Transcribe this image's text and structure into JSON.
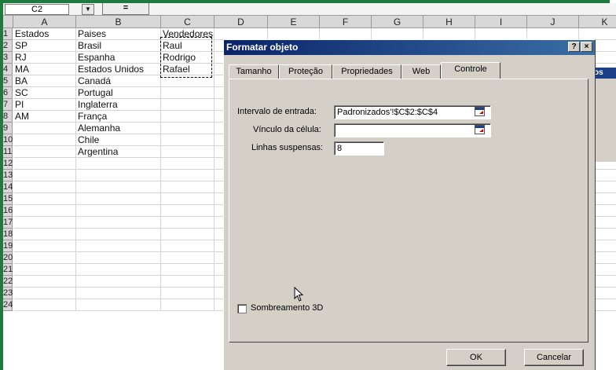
{
  "formula_bar": {
    "name_box": "C2",
    "equals": "="
  },
  "columns": [
    "A",
    "B",
    "C",
    "D",
    "E",
    "F",
    "G",
    "H",
    "I",
    "J",
    "K"
  ],
  "rows": [
    "1",
    "2",
    "3",
    "4",
    "5",
    "6",
    "7",
    "8",
    "9",
    "10",
    "11",
    "12",
    "13",
    "14",
    "15",
    "16",
    "17",
    "18",
    "19",
    "20",
    "21",
    "22",
    "23",
    "24"
  ],
  "cells": {
    "A": [
      "Estados",
      "SP",
      "RJ",
      "MA",
      "BA",
      "SC",
      "PI",
      "AM"
    ],
    "B": [
      "Paises",
      "Brasil",
      "Espanha",
      "Estados Unidos",
      "Canadá",
      "Portugal",
      "Inglaterra",
      "França",
      "Alemanha",
      "Chile",
      "Argentina"
    ],
    "C": [
      "Vendedores",
      "Raul",
      "Rodrigo",
      "Rafael"
    ]
  },
  "dialog": {
    "title": "Formatar objeto",
    "help": "?",
    "close": "×",
    "tabs": [
      "Tamanho",
      "Proteção",
      "Propriedades",
      "Web",
      "Controle"
    ],
    "active_tab": "Controle",
    "input_range_label": "Intervalo de entrada:",
    "input_range_value": "Padronizados'!$C$2:$C$4",
    "cell_link_label": "Vínculo da célula:",
    "cell_link_value": "",
    "dropdown_lines_label": "Linhas suspensas:",
    "dropdown_lines_value": "8",
    "shading_label": "Sombreamento 3D",
    "ok": "OK",
    "cancel": "Cancelar"
  },
  "background_window": {
    "title": "os"
  }
}
